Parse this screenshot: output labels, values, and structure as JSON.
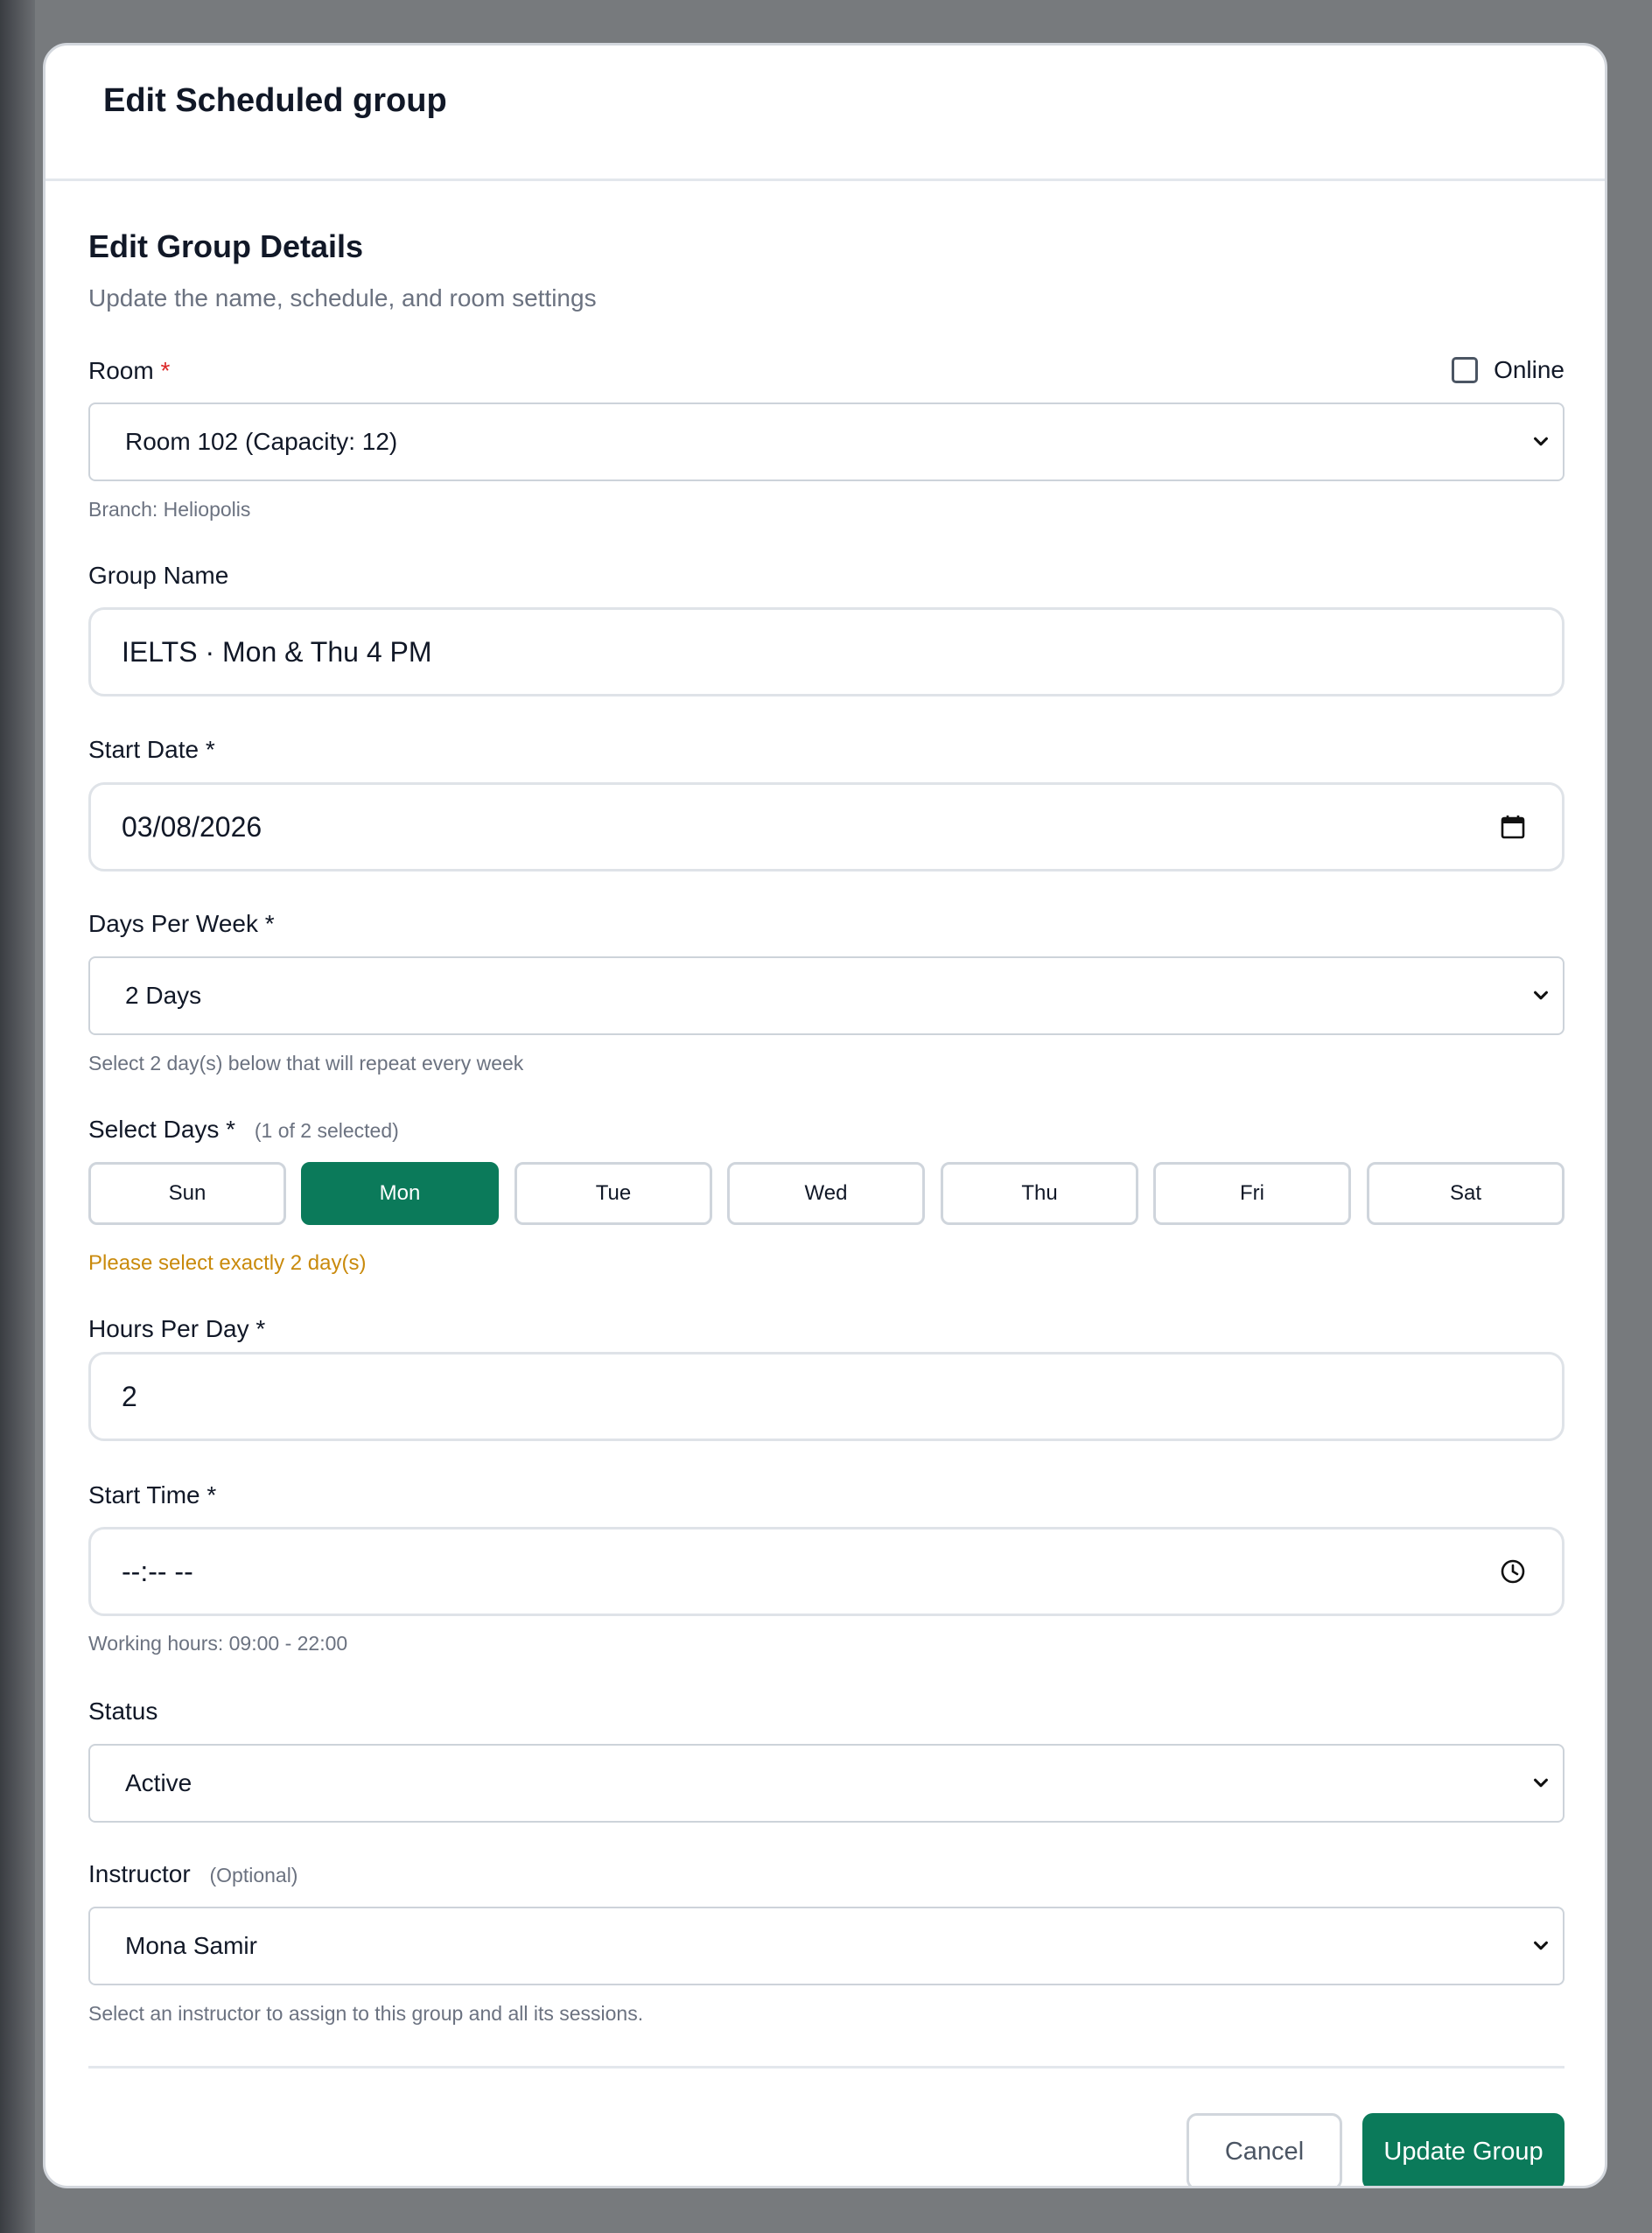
{
  "modal": {
    "title": "Edit Scheduled group"
  },
  "section": {
    "title": "Edit Group Details",
    "subtitle": "Update the name, schedule, and room settings"
  },
  "room": {
    "label": "Room",
    "required_mark": "*",
    "online_label": "Online",
    "online_checked": false,
    "selected": "Room 102 (Capacity: 12)",
    "hint": "Branch: Heliopolis"
  },
  "group_name": {
    "label": "Group Name",
    "value": "IELTS · Mon & Thu 4 PM"
  },
  "start_date": {
    "label": "Start Date *",
    "value": "03/08/2026",
    "icon": "calendar-icon"
  },
  "days_per_week": {
    "label": "Days Per Week *",
    "selected": "2 Days",
    "hint": "Select 2 day(s) below that will repeat every week"
  },
  "select_days": {
    "label": "Select Days *",
    "count_note": "(1 of 2 selected)",
    "days": [
      {
        "label": "Sun",
        "selected": false
      },
      {
        "label": "Mon",
        "selected": true
      },
      {
        "label": "Tue",
        "selected": false
      },
      {
        "label": "Wed",
        "selected": false
      },
      {
        "label": "Thu",
        "selected": false
      },
      {
        "label": "Fri",
        "selected": false
      },
      {
        "label": "Sat",
        "selected": false
      }
    ],
    "warning": "Please select exactly 2 day(s)"
  },
  "hours_per_day": {
    "label": "Hours Per Day *",
    "value": "2"
  },
  "start_time": {
    "label": "Start Time *",
    "value": "--:-- --",
    "icon": "clock-icon",
    "hint": "Working hours: 09:00 - 22:00"
  },
  "status": {
    "label": "Status",
    "selected": "Active"
  },
  "instructor": {
    "label": "Instructor",
    "optional_note": "(Optional)",
    "selected": "Mona Samir",
    "hint": "Select an instructor to assign to this group and all its sessions."
  },
  "footer": {
    "cancel_label": "Cancel",
    "submit_label": "Update Group"
  },
  "colors": {
    "primary": "#0b7a5a",
    "warning": "#c98a0c",
    "required": "#dc2626",
    "muted": "#6b7280"
  }
}
